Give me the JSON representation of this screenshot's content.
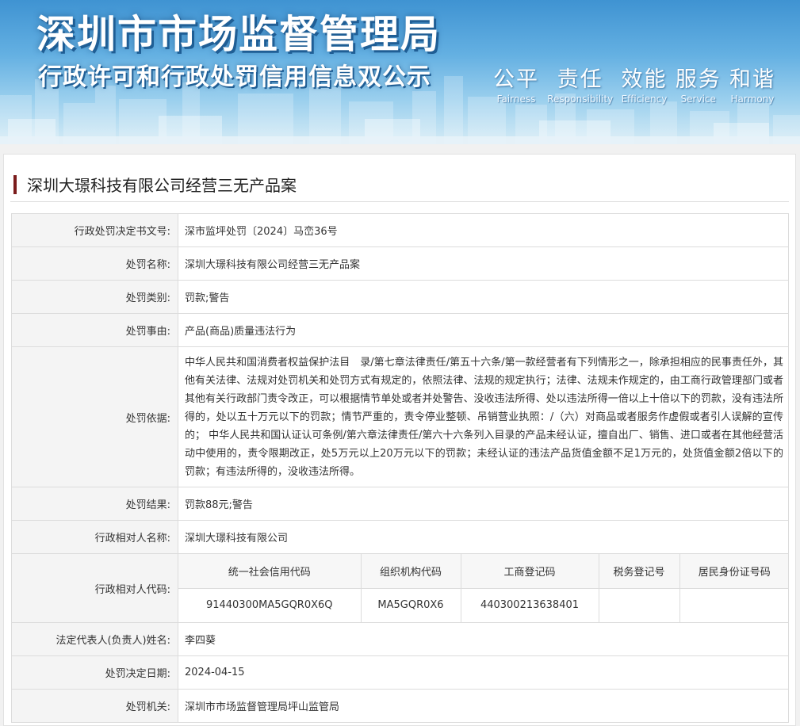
{
  "banner": {
    "title": "深圳市市场监督管理局",
    "subtitle": "行政许可和行政处罚信用信息双公示",
    "slogans": [
      {
        "cn": "公平",
        "en": "Fairness"
      },
      {
        "cn": "责任",
        "en": "Responsibility"
      },
      {
        "cn": "效能",
        "en": "Efficiency"
      },
      {
        "cn": "服务",
        "en": "Service"
      },
      {
        "cn": "和谐",
        "en": "Harmony"
      }
    ]
  },
  "case_title": "深圳大璟科技有限公司经营三无产品案",
  "fields": {
    "doc_no": {
      "label": "行政处罚决定书文号:",
      "value": "深市监坪处罚〔2024〕马峦36号"
    },
    "name": {
      "label": "处罚名称:",
      "value": "深圳大璟科技有限公司经营三无产品案"
    },
    "category": {
      "label": "处罚类别:",
      "value": "罚款;警告"
    },
    "reason": {
      "label": "处罚事由:",
      "value": "产品(商品)质量违法行为"
    },
    "basis": {
      "label": "处罚依据:",
      "value": "中华人民共和国消费者权益保护法目　录/第七章法律责任/第五十六条/第一款经营者有下列情形之一，除承担相应的民事责任外，其他有关法律、法规对处罚机关和处罚方式有规定的，依照法律、法规的规定执行；法律、法规未作规定的，由工商行政管理部门或者其他有关行政部门责令改正，可以根据情节单处或者并处警告、没收违法所得、处以违法所得一倍以上十倍以下的罚款，没有违法所得的，处以五十万元以下的罚款；情节严重的，责令停业整顿、吊销营业执照：/（六）对商品或者服务作虚假或者引人误解的宣传的； 中华人民共和国认证认可条例/第六章法律责任/第六十六条列入目录的产品未经认证，擅自出厂、销售、进口或者在其他经营活动中使用的，责令限期改正，处5万元以上20万元以下的罚款；未经认证的违法产品货值金额不足1万元的，处货值金额2倍以下的罚款；有违法所得的，没收违法所得。"
    },
    "result": {
      "label": "处罚结果:",
      "value": "罚款88元;警告"
    },
    "party_name": {
      "label": "行政相对人名称:",
      "value": "深圳大璟科技有限公司"
    },
    "party_code": {
      "label": "行政相对人代码:",
      "headers": [
        "统一社会信用代码",
        "组织机构代码",
        "工商登记码",
        "税务登记号",
        "居民身份证号码"
      ],
      "values": [
        "91440300MA5GQR0X6Q",
        "MA5GQR0X6",
        "440300213638401",
        "",
        ""
      ]
    },
    "legal_rep": {
      "label": "法定代表人(负责人)姓名:",
      "value": "李四葵"
    },
    "decision_date": {
      "label": "处罚决定日期:",
      "value": "2024-04-15"
    },
    "authority": {
      "label": "处罚机关:",
      "value": "深圳市市场监督管理局坪山监管局"
    }
  }
}
